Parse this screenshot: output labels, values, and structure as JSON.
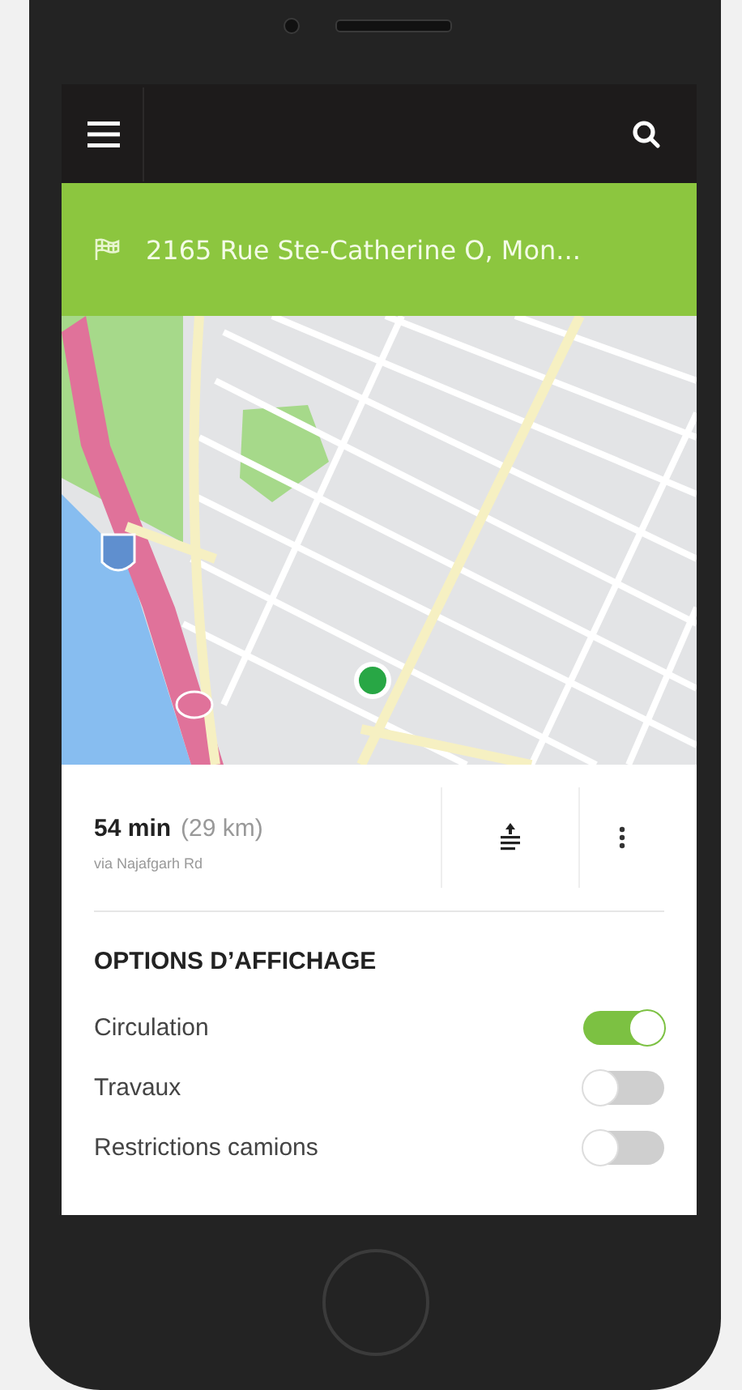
{
  "destination": {
    "address": "2165 Rue Ste-Catherine O, Mon..."
  },
  "route": {
    "duration": "54 min",
    "distance": "(29 km)",
    "via": "via Najafgarh Rd"
  },
  "options": {
    "title": "OPTIONS D’AFFICHAGE",
    "items": [
      {
        "label": "Circulation",
        "on": true
      },
      {
        "label": "Travaux",
        "on": false
      },
      {
        "label": "Restrictions camions",
        "on": false
      }
    ]
  }
}
